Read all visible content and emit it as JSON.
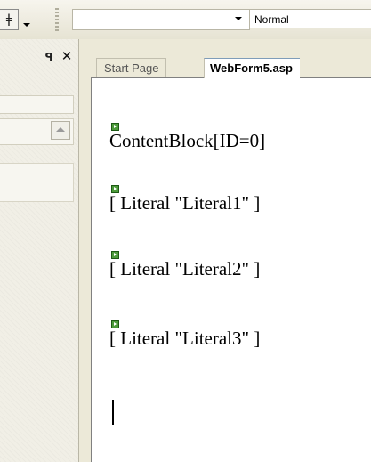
{
  "toolbar": {
    "block_format": "",
    "style_value": "Normal"
  },
  "left_panel": {
    "pin_glyph": "ₚ",
    "close_glyph": "✕"
  },
  "tabs": [
    {
      "label": "Start Page",
      "active": false
    },
    {
      "label": "WebForm5.asp",
      "active": true
    }
  ],
  "design": {
    "lines": [
      "ContentBlock[ID=0]",
      "[ Literal \"Literal1\" ]",
      "[ Literal \"Literal2\" ]",
      "[ Literal \"Literal3\" ]"
    ]
  },
  "colors": {
    "chrome": "#ece9d8",
    "glyph": "#4c9a3a"
  }
}
